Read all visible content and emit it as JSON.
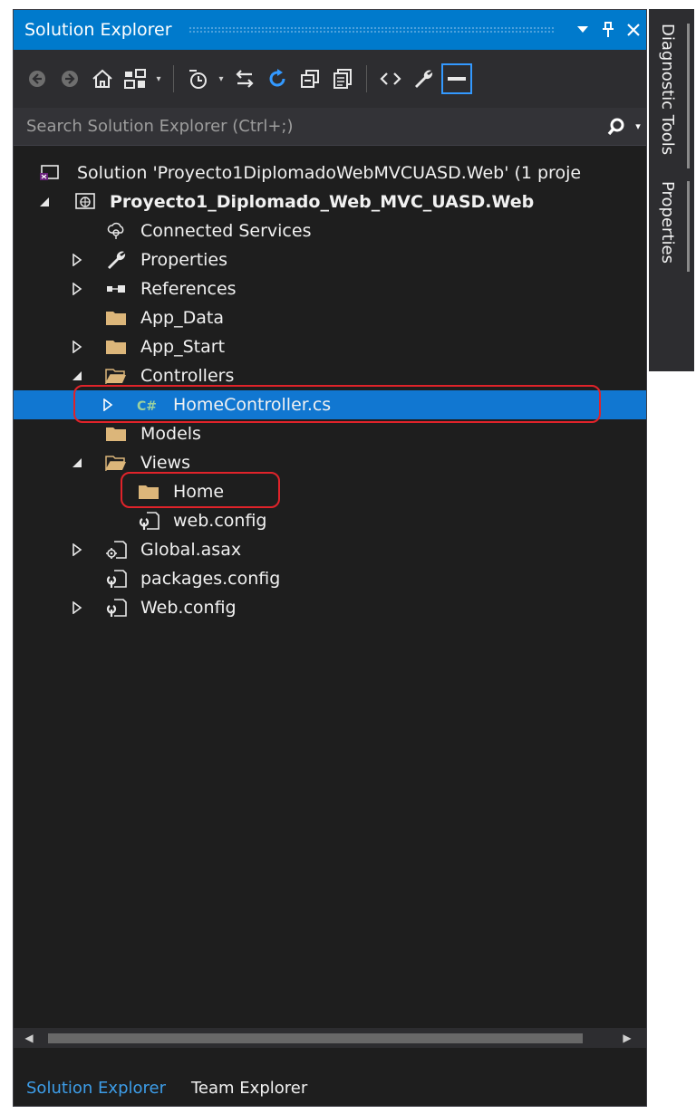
{
  "panel": {
    "title": "Solution Explorer"
  },
  "search": {
    "placeholder": "Search Solution Explorer (Ctrl+;)"
  },
  "tree": {
    "solution": "Solution 'Proyecto1DiplomadoWebMVCUASD.Web' (1 proje",
    "project": "Proyecto1_Diplomado_Web_MVC_UASD.Web",
    "connected_services": "Connected Services",
    "properties": "Properties",
    "references": "References",
    "app_data": "App_Data",
    "app_start": "App_Start",
    "controllers": "Controllers",
    "home_controller": "HomeController.cs",
    "models": "Models",
    "views": "Views",
    "home": "Home",
    "views_web_config": "web.config",
    "global_asax": "Global.asax",
    "packages_config": "packages.config",
    "web_config": "Web.config"
  },
  "bottom_tabs": {
    "solution_explorer": "Solution Explorer",
    "team_explorer": "Team Explorer"
  },
  "side_tabs": {
    "diagnostic_tools": "Diagnostic Tools",
    "properties": "Properties"
  },
  "colors": {
    "title_bar": "#007acc",
    "selection": "#1177d1",
    "highlight": "#e0232a",
    "folder": "#dcb67a",
    "background": "#1e1e1e"
  },
  "icons": {
    "toolbar": [
      "back-icon",
      "forward-icon",
      "home-icon",
      "sync-view-icon",
      "pending-changes-filter-icon",
      "sync-active-document-icon",
      "refresh-icon",
      "collapse-all-icon",
      "show-all-files-icon",
      "view-code-icon",
      "properties-wrench-icon",
      "preview-selected-item-icon"
    ]
  }
}
